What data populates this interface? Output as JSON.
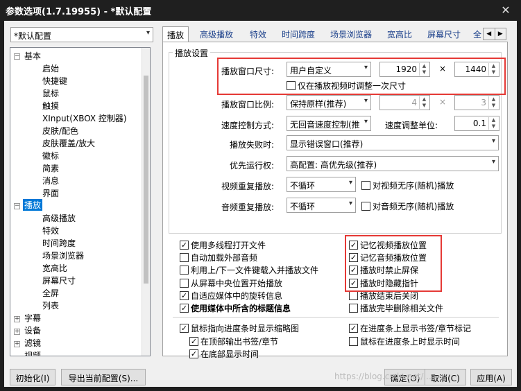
{
  "window": {
    "title": "参数选项(1.7.19955) - *默认配置"
  },
  "profile_combo": "*默认配置",
  "tabs": [
    "播放",
    "高级播放",
    "特效",
    "时间跨度",
    "场景浏览器",
    "宽高比",
    "屏幕尺寸",
    "全"
  ],
  "tree": {
    "basic": {
      "label": "基本",
      "children": [
        "启始",
        "快捷键",
        "鼠标",
        "触摸",
        "XInput(XBOX 控制器)",
        "皮肤/配色",
        "皮肤覆盖/放大",
        "徽标",
        "简素",
        "消息",
        "界面"
      ]
    },
    "play": {
      "label": "播放",
      "children": [
        "高级播放",
        "特效",
        "时间跨度",
        "场景浏览器",
        "宽高比",
        "屏幕尺寸",
        "全屏",
        "列表"
      ]
    },
    "others": [
      "字幕",
      "设备",
      "滤镜",
      "视频"
    ]
  },
  "group_title": "播放设置",
  "settings": {
    "window_size": {
      "label": "播放窗口尺寸:",
      "value": "用户自定义",
      "width": "1920",
      "height": "1440",
      "times": "×"
    },
    "adjust_once": "仅在播放视频时调整一次尺寸",
    "ratio": {
      "label": "播放窗口比例:",
      "value": "保持原样(推荐)",
      "w": "4",
      "h": "3",
      "times": "×"
    },
    "speed": {
      "label": "速度控制方式:",
      "value": "无回音速度控制(推",
      "unit_label": "速度调整单位:",
      "unit_value": "0.1"
    },
    "fail": {
      "label": "播放失败时:",
      "value": "显示错误窗口(推荐)"
    },
    "priority": {
      "label": "优先运行权:",
      "value": "高配置: 高优先级(推荐)"
    },
    "video_repeat": {
      "label": "视频重复播放:",
      "value": "不循环",
      "random": "对视频无序(随机)播放"
    },
    "audio_repeat": {
      "label": "音频重复播放:",
      "value": "不循环",
      "random": "对音频无序(随机)播放"
    }
  },
  "options_left": [
    {
      "label": "使用多线程打开文件",
      "checked": "✓"
    },
    {
      "label": "自动加载外部音频",
      "checked": ""
    },
    {
      "label": "利用上/下一文件键载入并播放文件",
      "checked": ""
    },
    {
      "label": "从屏幕中央位置开始播放",
      "checked": ""
    },
    {
      "label": "自适应媒体中的旋转信息",
      "checked": "✓"
    },
    {
      "label": "使用媒体中所含的标题信息",
      "checked": "✓"
    }
  ],
  "options_right": [
    {
      "label": "记忆视频播放位置",
      "checked": "✓"
    },
    {
      "label": "记忆音频播放位置",
      "checked": "✓"
    },
    {
      "label": "播放时禁止屏保",
      "checked": "✓"
    },
    {
      "label": "播放时隐藏指针",
      "checked": "✓"
    },
    {
      "label": "播放结束后关闭",
      "checked": ""
    },
    {
      "label": "播放完毕删除相关文件",
      "checked": ""
    }
  ],
  "thumb": {
    "main": "鼠标指向进度条时显示缩略图",
    "top": "在顶部输出书签/章节",
    "bottom": "在底部显示时间",
    "bookmark": "在进度条上显示书签/章节标记",
    "time": "鼠标在进度条上时显示时间"
  },
  "buttons": {
    "init": "初始化(I)",
    "export": "导出当前配置(S)...",
    "ok": "确定(O)",
    "cancel": "取消(C)",
    "apply": "应用(A)"
  },
  "watermark": "https://blog.csdn.net/..."
}
